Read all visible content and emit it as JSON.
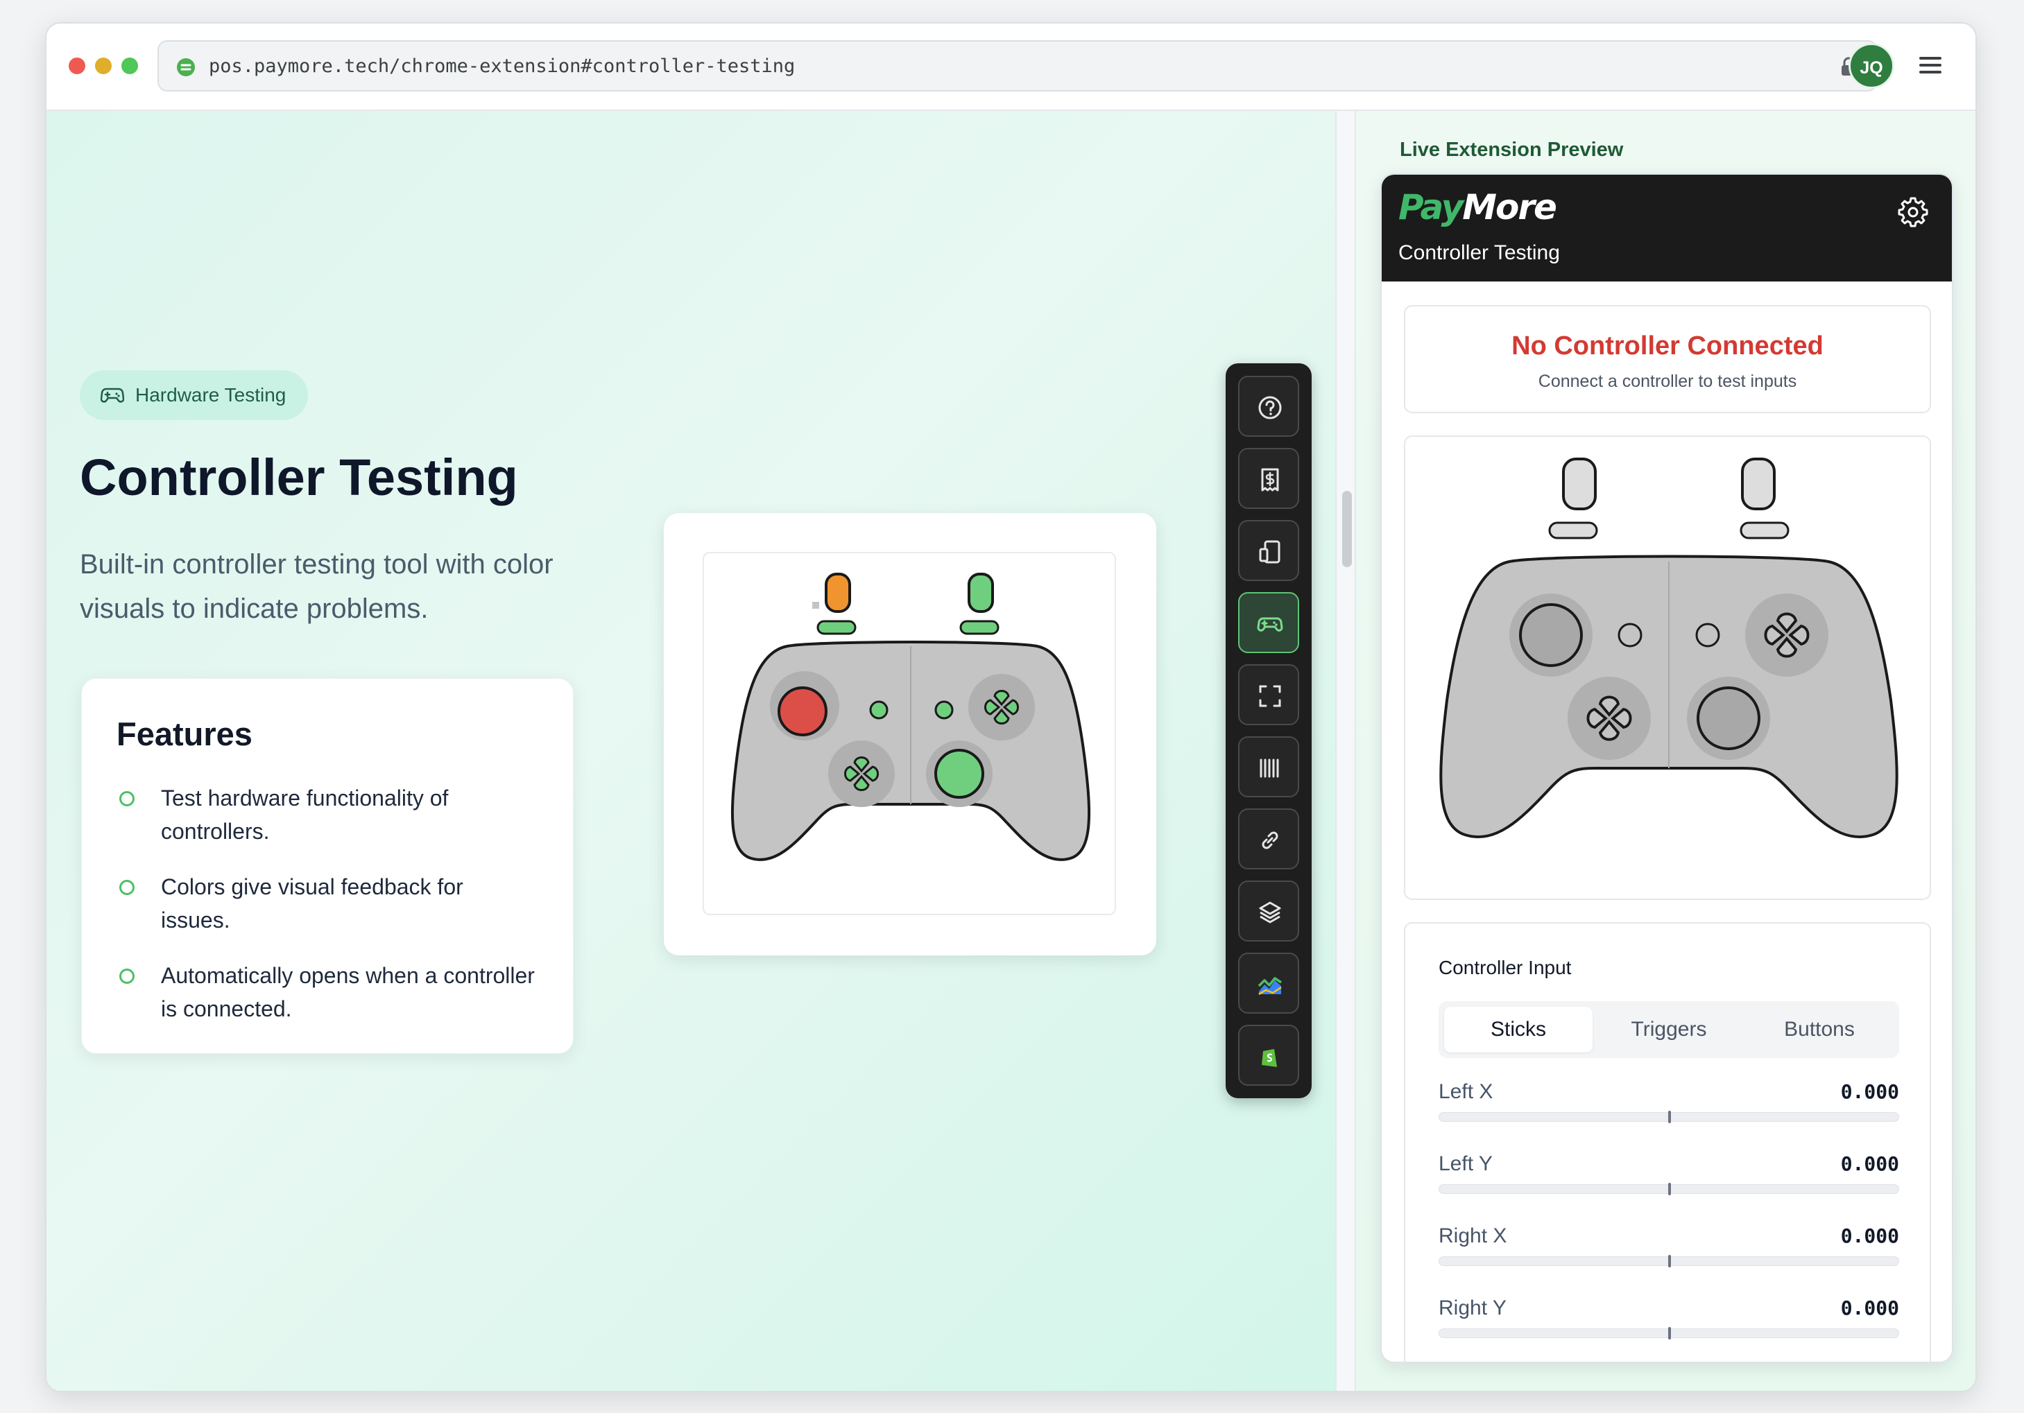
{
  "browser": {
    "url": "pos.paymore.tech/chrome-extension#controller-testing",
    "avatar_initials": "JQ",
    "icons": [
      "favicon",
      "lock-icon",
      "menu-icon"
    ]
  },
  "hero": {
    "badge": "Hardware Testing",
    "title": "Controller Testing",
    "subtitle": "Built-in controller testing tool with color visuals to indicate problems."
  },
  "features": {
    "title": "Features",
    "items": [
      "Test hardware functionality of controllers.",
      "Colors give visual feedback for issues.",
      "Automatically opens when a controller is connected."
    ]
  },
  "toolbar": {
    "icons": [
      "help-icon",
      "receipt-dollar-icon",
      "devices-icon",
      "gamepad-icon",
      "scan-icon",
      "barcode-icon",
      "link-icon",
      "layers-icon",
      "chart-icon",
      "shopify-icon"
    ],
    "active": "gamepad-icon"
  },
  "preview": {
    "label": "Live Extension Preview",
    "logo_pay": "Pay",
    "logo_more": "More",
    "subtitle": "Controller Testing",
    "status_title": "No Controller Connected",
    "status_sub": "Connect a controller to test inputs",
    "input_title": "Controller Input",
    "tabs": [
      "Sticks",
      "Triggers",
      "Buttons"
    ],
    "active_tab": "Sticks",
    "axes": [
      {
        "label": "Left X",
        "value": "0.000"
      },
      {
        "label": "Left Y",
        "value": "0.000"
      },
      {
        "label": "Right X",
        "value": "0.000"
      },
      {
        "label": "Right Y",
        "value": "0.000"
      }
    ]
  },
  "colors": {
    "accent": "#4cc065",
    "error": "#d33a32",
    "warning": "#f0942f",
    "controller_body": "#c4c4c4",
    "toolbar_bg": "#1e1e1e"
  }
}
